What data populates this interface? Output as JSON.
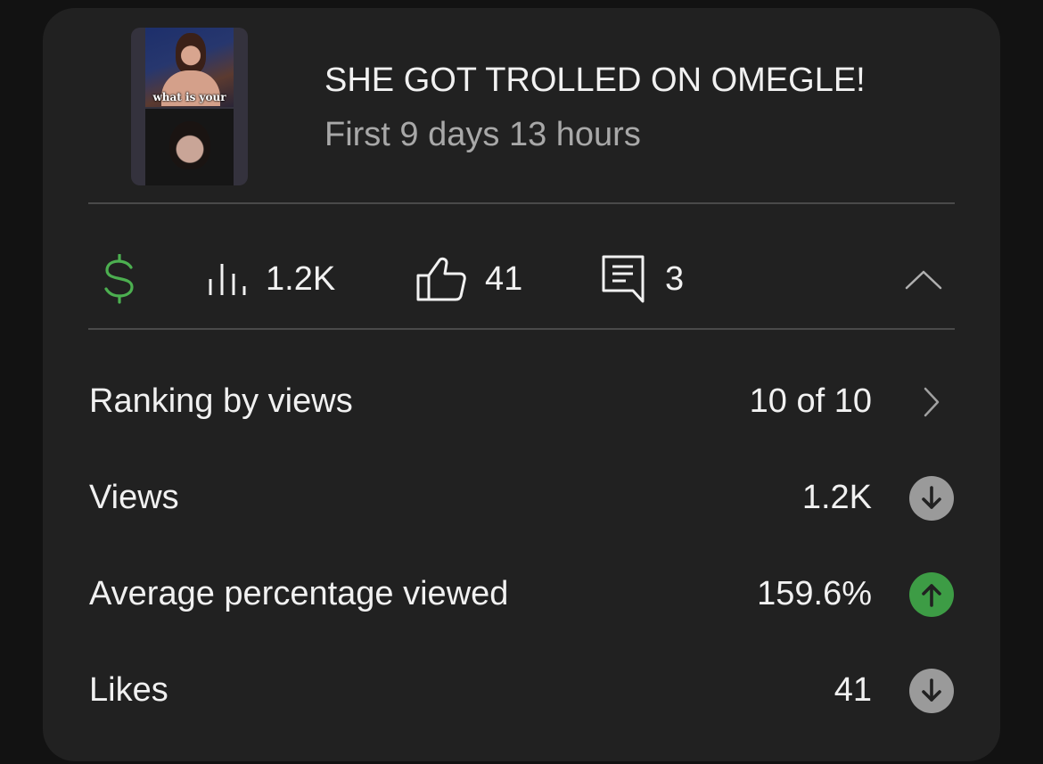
{
  "video": {
    "title": "SHE GOT TROLLED ON OMEGLE!",
    "period": "First 9 days 13 hours",
    "thumbnail_caption": "what is your"
  },
  "metrics_bar": {
    "monetization_icon": "dollar-icon",
    "views": "1.2K",
    "likes": "41",
    "comments": "3",
    "collapse_icon": "chevron-up-icon"
  },
  "stats": [
    {
      "label": "Ranking by views",
      "value": "10 of 10",
      "icon": "chevron-right-icon"
    },
    {
      "label": "Views",
      "value": "1.2K",
      "icon": "arrow-down-circle-icon",
      "trend": "down"
    },
    {
      "label": "Average percentage viewed",
      "value": "159.6%",
      "icon": "arrow-up-circle-icon",
      "trend": "up"
    },
    {
      "label": "Likes",
      "value": "41",
      "icon": "arrow-down-circle-icon",
      "trend": "down"
    }
  ],
  "colors": {
    "background": "#121212",
    "card": "#212121",
    "divider": "#4a4a4a",
    "monetization": "#4caf50",
    "trend_up": "#3d9c45",
    "trend_down": "#9a9a9a",
    "muted_text": "#a8a8a8"
  }
}
